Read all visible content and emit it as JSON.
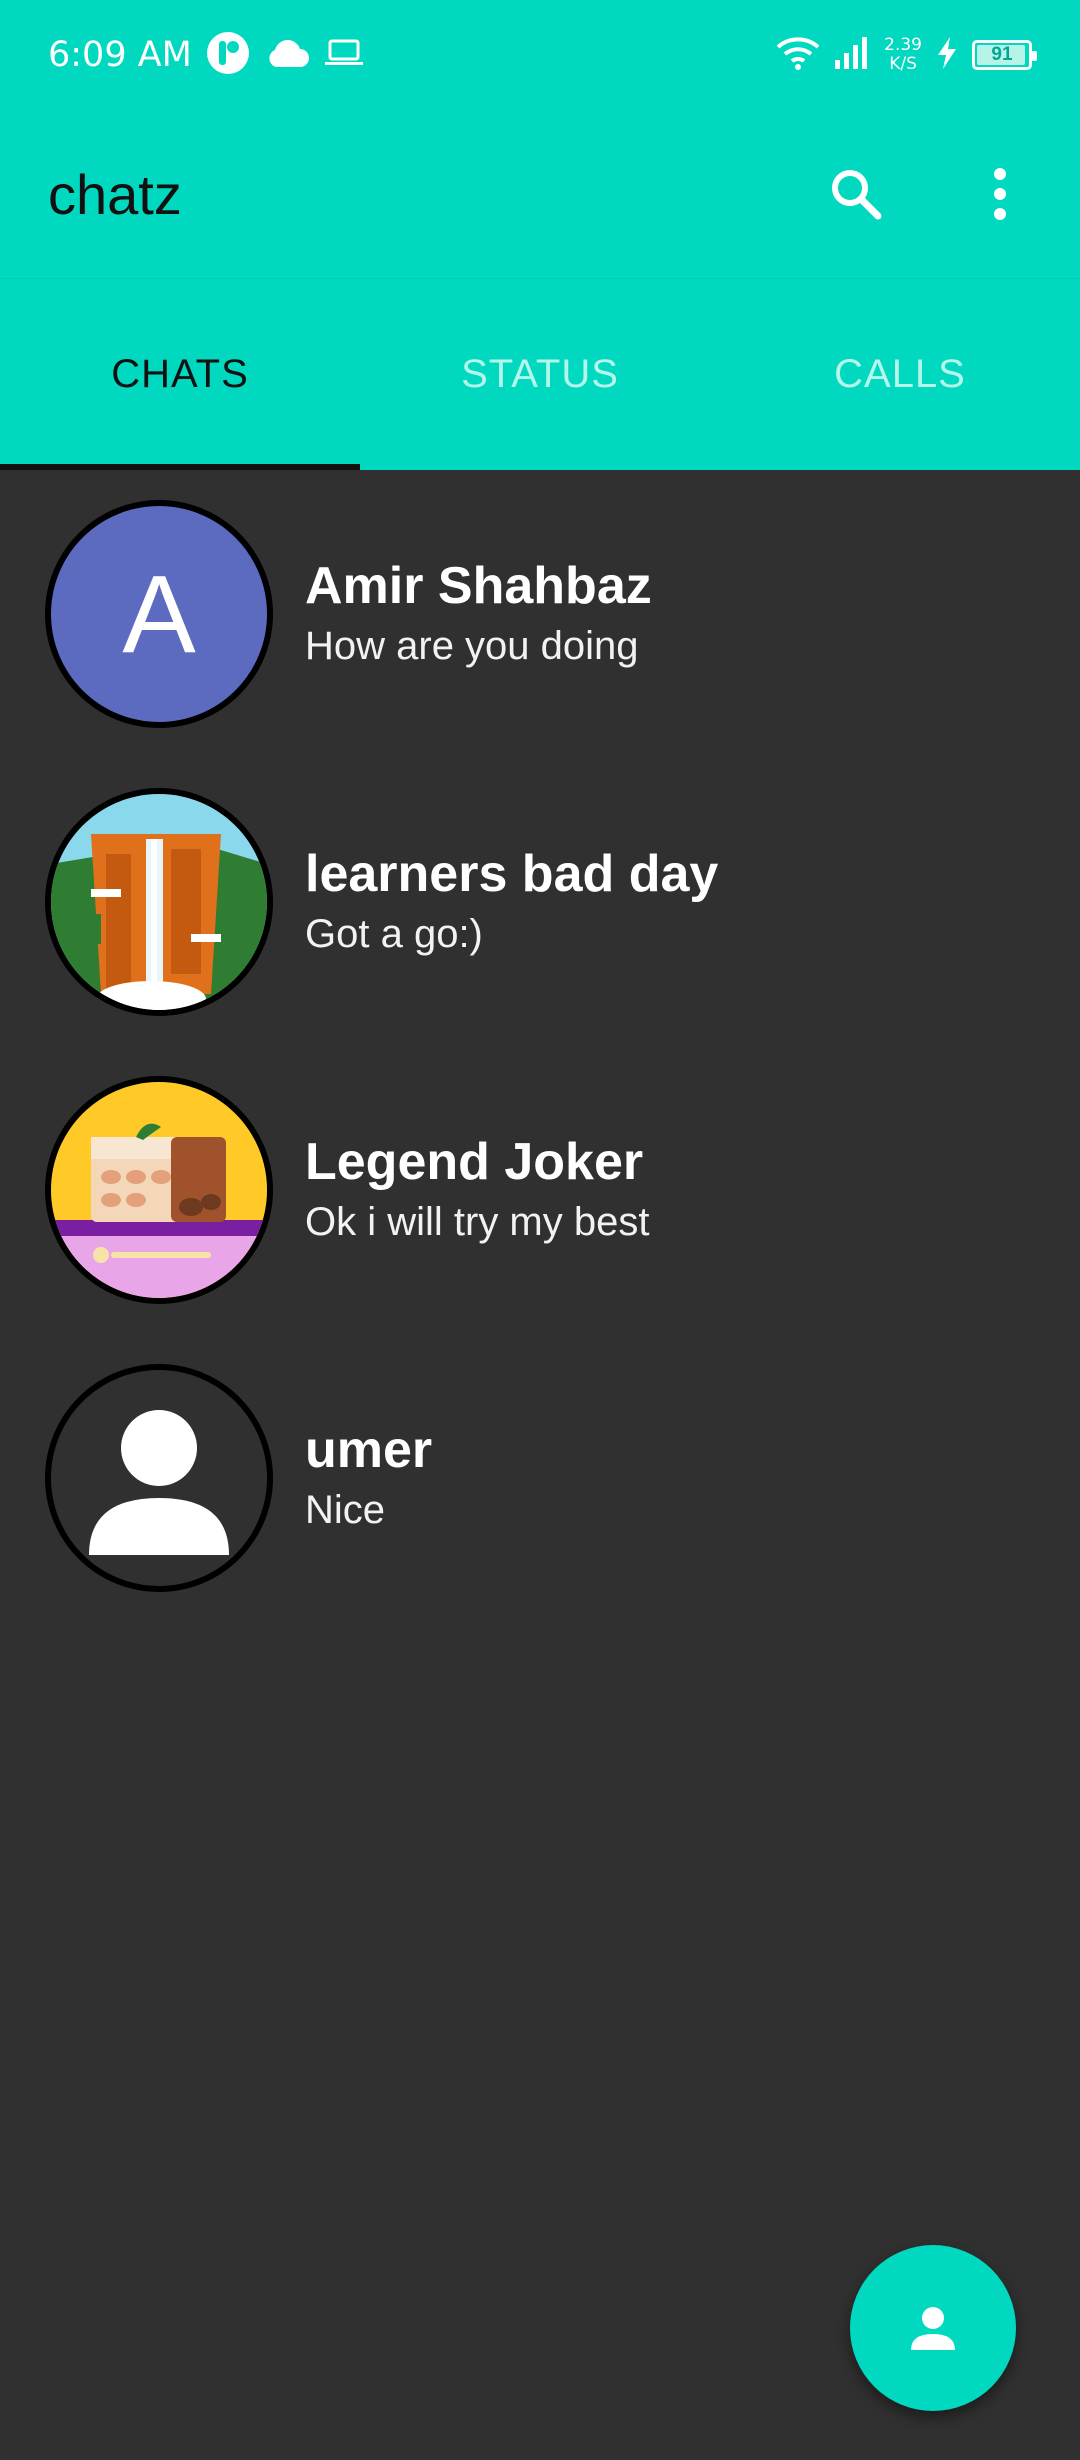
{
  "status_bar": {
    "time": "6:09 AM",
    "net_speed_value": "2.39",
    "net_speed_unit": "K/S",
    "battery": "91",
    "icons": [
      "app-notification-icon",
      "cloud-icon",
      "laptop-icon",
      "wifi-icon",
      "signal-icon",
      "charging-icon",
      "battery-icon"
    ]
  },
  "app_bar": {
    "title": "chatz",
    "actions": [
      "search-icon",
      "more-vert-icon"
    ]
  },
  "tabs": [
    {
      "label": "CHATS",
      "active": true
    },
    {
      "label": "STATUS",
      "active": false
    },
    {
      "label": "CALLS",
      "active": false
    }
  ],
  "chats": [
    {
      "name": "Amir Shahbaz",
      "message": "How are you doing",
      "avatar": {
        "type": "letter",
        "letter": "A",
        "color": "#5c6bc0"
      }
    },
    {
      "name": "learners bad day",
      "message": "Got a go:)",
      "avatar": {
        "type": "image",
        "icon": "waterfall-illustration"
      }
    },
    {
      "name": "Legend Joker",
      "message": "Ok i will try my best",
      "avatar": {
        "type": "image",
        "icon": "food-illustration"
      }
    },
    {
      "name": "umer",
      "message": "Nice",
      "avatar": {
        "type": "placeholder",
        "icon": "person-icon"
      }
    }
  ],
  "fab": {
    "icon": "contacts-icon"
  },
  "colors": {
    "accent": "#00d9c0",
    "background": "#303030",
    "tab_inactive": "#b6f5ec",
    "avatar_letter_bg": "#5c6bc0"
  }
}
